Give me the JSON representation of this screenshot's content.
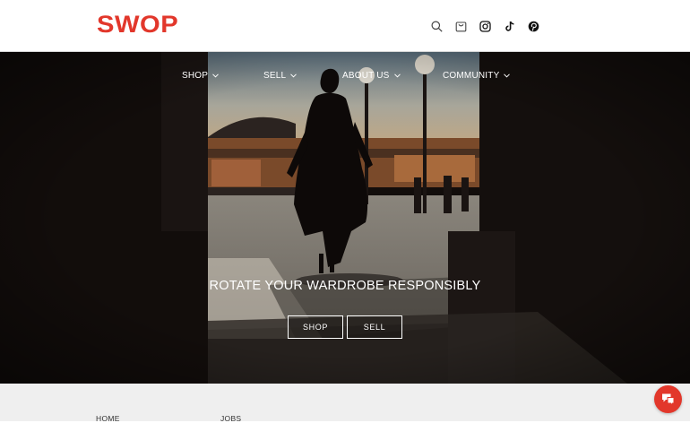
{
  "brand": {
    "logo_text": "SWOP",
    "accent_color": "#e2372b"
  },
  "header": {
    "icons": [
      "search-icon",
      "cart-icon",
      "instagram-icon",
      "tiktok-icon",
      "pinterest-icon"
    ]
  },
  "nav": {
    "items": [
      {
        "label": "SHOP"
      },
      {
        "label": "SELL"
      },
      {
        "label": "ABOUT US"
      },
      {
        "label": "COMMUNITY"
      }
    ]
  },
  "hero": {
    "title": "ROTATE YOUR WARDROBE RESPONSIBLY",
    "shop_label": "SHOP",
    "sell_label": "SELL"
  },
  "footer": {
    "links": [
      "HOME",
      "JOBS"
    ]
  },
  "chat": {
    "icon": "chat-icon"
  }
}
